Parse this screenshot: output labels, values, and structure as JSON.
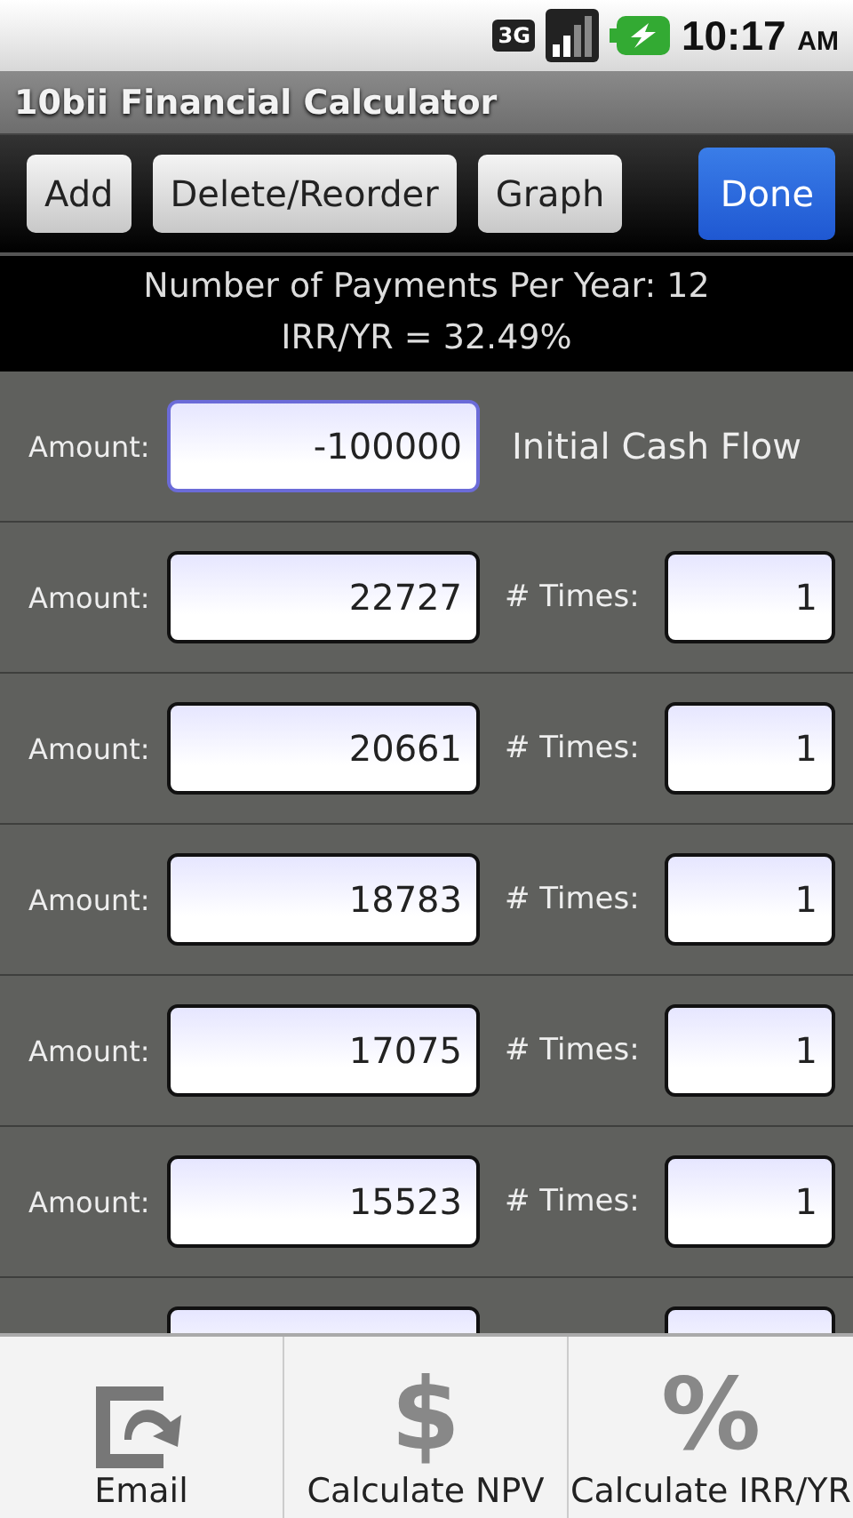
{
  "status_bar": {
    "network": "3G",
    "time": "10:17",
    "ampm": "AM"
  },
  "title": "10bii Financial Calculator",
  "toolbar": [
    {
      "label": "Add",
      "primary": false
    },
    {
      "label": "Delete/Reorder",
      "primary": false
    },
    {
      "label": "Graph",
      "primary": false
    },
    {
      "label": "Done",
      "primary": true
    }
  ],
  "info": [
    "Number of Payments Per Year: 12",
    "IRR/YR = 32.49%"
  ],
  "rows": [
    {
      "kind": "initial",
      "label": "Amount:",
      "amount": "-100000",
      "focused": true,
      "note": "Initial Cash Flow"
    },
    {
      "kind": "flow",
      "label": "Amount:",
      "amount": "22727",
      "focused": false,
      "times_label": "# Times:",
      "times": "1"
    },
    {
      "kind": "flow",
      "label": "Amount:",
      "amount": "20661",
      "focused": false,
      "times_label": "# Times:",
      "times": "1"
    },
    {
      "kind": "flow",
      "label": "Amount:",
      "amount": "18783",
      "focused": false,
      "times_label": "# Times:",
      "times": "1"
    },
    {
      "kind": "flow",
      "label": "Amount:",
      "amount": "17075",
      "focused": false,
      "times_label": "# Times:",
      "times": "1"
    },
    {
      "kind": "flow",
      "label": "Amount:",
      "amount": "15523",
      "focused": false,
      "times_label": "# Times:",
      "times": "1"
    },
    {
      "kind": "hidden"
    }
  ],
  "menu": [
    {
      "kind": "email",
      "label": "Email"
    },
    {
      "kind": "glyph",
      "glyph": "$",
      "label": "Calculate NPV"
    },
    {
      "kind": "glyph",
      "glyph": "%",
      "label": "Calculate IRR/YR"
    }
  ]
}
